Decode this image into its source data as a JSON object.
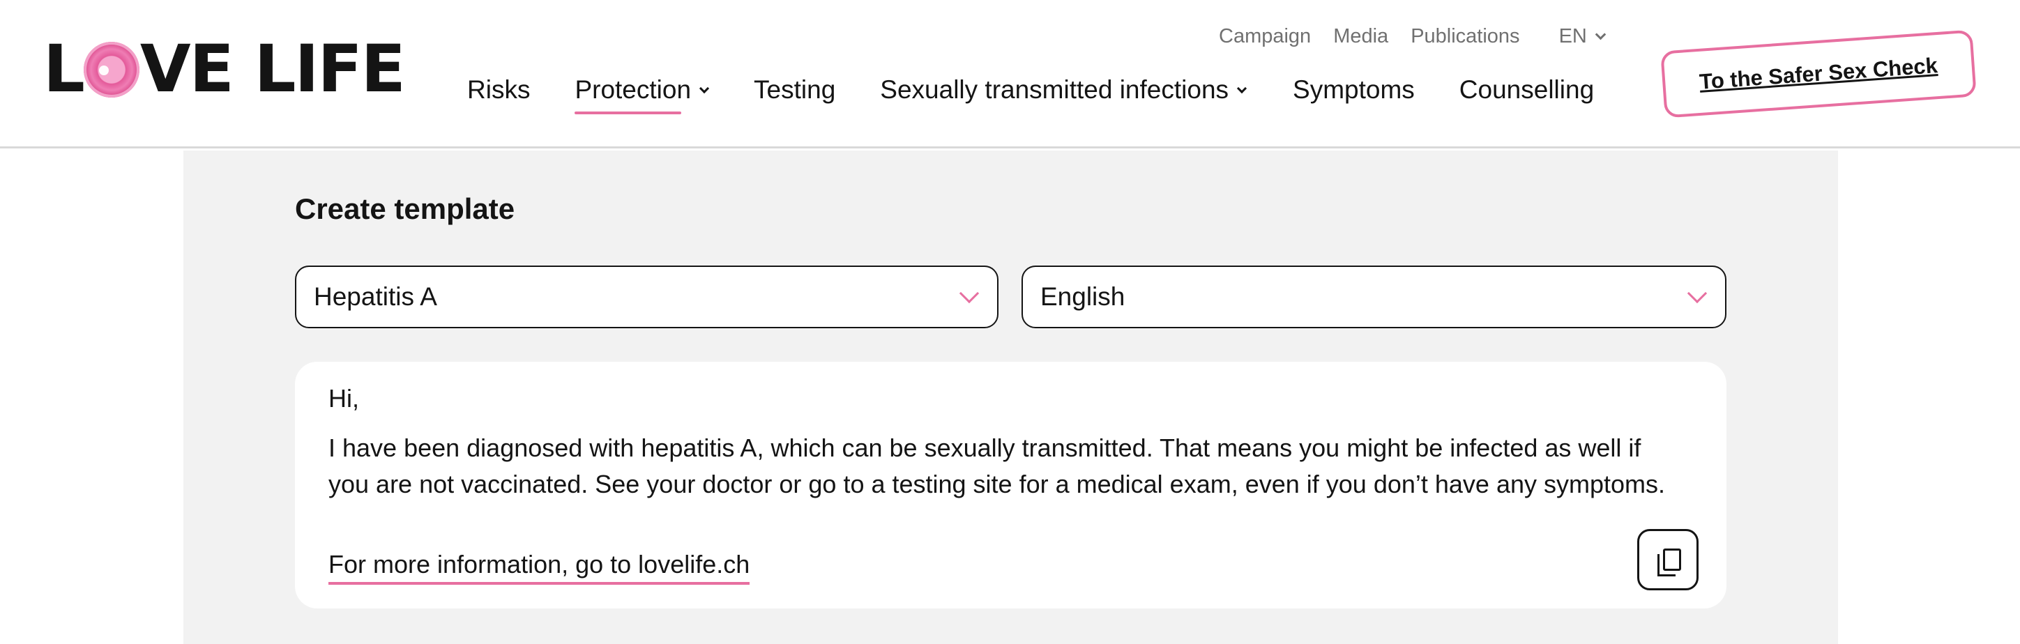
{
  "logo": {
    "before": "L",
    "after": "VE LIFE"
  },
  "topnav": {
    "links": [
      "Campaign",
      "Media",
      "Publications"
    ],
    "language": "EN"
  },
  "mainnav": {
    "items": [
      {
        "label": "Risks"
      },
      {
        "label": "Protection"
      },
      {
        "label": "Testing"
      },
      {
        "label": "Sexually transmitted infections"
      },
      {
        "label": "Symptoms"
      },
      {
        "label": "Counselling"
      }
    ]
  },
  "cta": {
    "label": "To the Safer Sex Check"
  },
  "template": {
    "title": "Create template",
    "infection_select": {
      "value": "Hepatitis A"
    },
    "language_select": {
      "value": "English"
    },
    "greeting": "Hi,",
    "message": "I have been diagnosed with hepatitis A, which can be sexually transmitted. That means you might be infected as well if you are not vaccinated. See your doctor or go to a testing site for a medical exam, even if you don’t have any symptoms.",
    "more_link": "For more information, go to lovelife.ch"
  },
  "colors": {
    "accent": "#e76fa0",
    "panel_bg": "#f2f2f2",
    "text": "#141414",
    "muted": "#707070"
  }
}
